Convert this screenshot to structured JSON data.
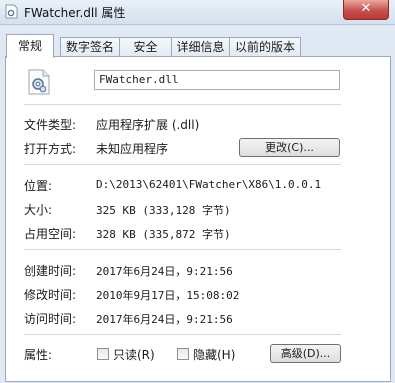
{
  "window": {
    "title": "FWatcher.dll 属性",
    "close_label": "✕"
  },
  "tabs": [
    {
      "label": "常规"
    },
    {
      "label": "数字签名"
    },
    {
      "label": "安全"
    },
    {
      "label": "详细信息"
    },
    {
      "label": "以前的版本"
    }
  ],
  "general": {
    "file_name": "FWatcher.dll",
    "type_label": "文件类型:",
    "type_value": "应用程序扩展 (.dll)",
    "open_with_label": "打开方式:",
    "open_with_value": "未知应用程序",
    "change_button": "更改(C)...",
    "location_label": "位置:",
    "location_value": "D:\\2013\\62401\\FWatcher\\X86\\1.0.0.1",
    "size_label": "大小:",
    "size_value": "325 KB (333,128 字节)",
    "size_on_disk_label": "占用空间:",
    "size_on_disk_value": "328 KB (335,872 字节)",
    "created_label": "创建时间:",
    "created_value": "2017年6月24日，9:21:56",
    "modified_label": "修改时间:",
    "modified_value": "2010年9月17日，15:08:02",
    "accessed_label": "访问时间:",
    "accessed_value": "2017年6月24日，9:21:56",
    "attributes_label": "属性:",
    "readonly_label": "只读(R)",
    "hidden_label": "隐藏(H)",
    "advanced_button": "高级(D)..."
  },
  "icons": {
    "title_icon": "dll-file-icon",
    "file_icon": "dll-gear-file-icon"
  }
}
